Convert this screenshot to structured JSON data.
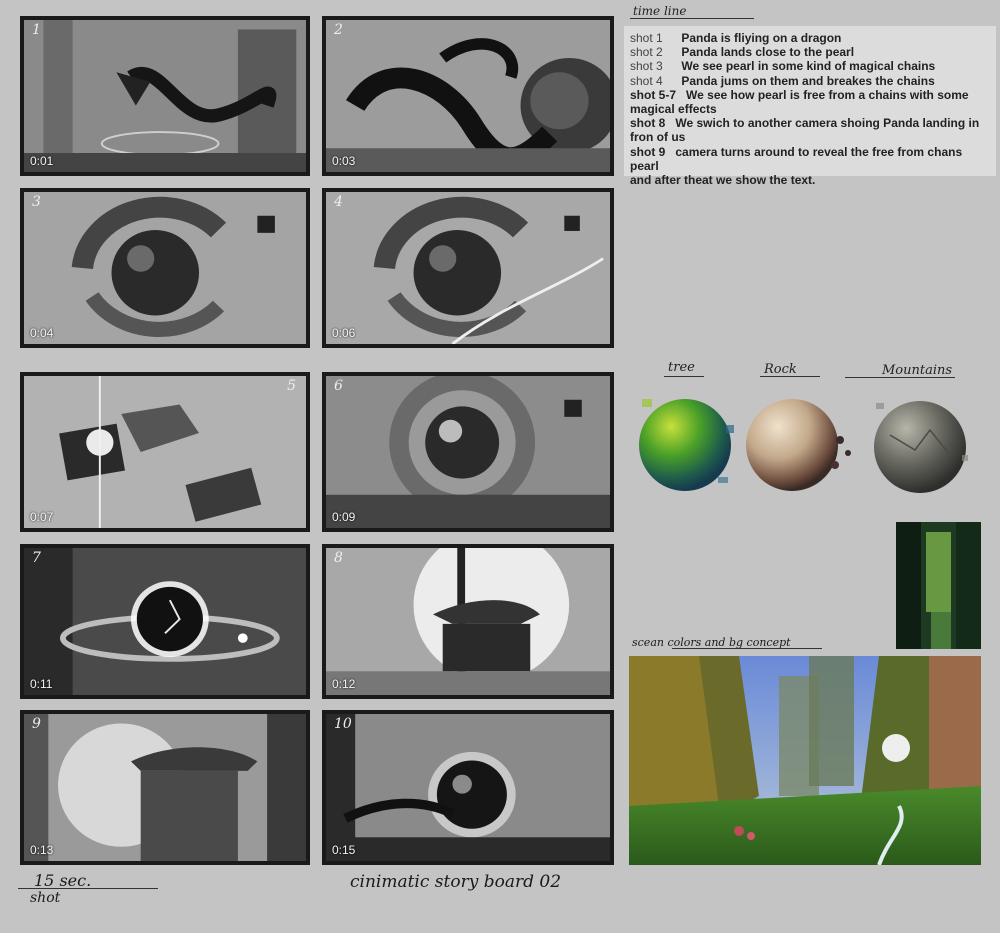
{
  "shots": [
    {
      "num": "1",
      "time": "0:01"
    },
    {
      "num": "2",
      "time": "0:03"
    },
    {
      "num": "3",
      "time": "0:04"
    },
    {
      "num": "4",
      "time": "0:06"
    },
    {
      "num": "5",
      "time": "0:07"
    },
    {
      "num": "6",
      "time": "0:09"
    },
    {
      "num": "7",
      "time": "0:11"
    },
    {
      "num": "8",
      "time": "0:12"
    },
    {
      "num": "9",
      "time": "0:13"
    },
    {
      "num": "10",
      "time": "0:15"
    }
  ],
  "timeline": {
    "title": "time line",
    "rows": [
      {
        "key": "shot 1",
        "text": "Panda is fliying on a dragon"
      },
      {
        "key": "shot 2",
        "text": "Panda lands close to the pearl"
      },
      {
        "key": "shot 3",
        "text": "We see pearl in some kind of magical chains"
      },
      {
        "key": "shot 4",
        "text": "Panda jums on them and breakes the chains"
      },
      {
        "key": "shot 5-7",
        "text": "We see how pearl is free from a chains with some"
      },
      {
        "key": "",
        "text": "magical effects"
      },
      {
        "key": "shot 8",
        "text": "We swich to another camera shoing Panda landing in"
      },
      {
        "key": "",
        "text": "fron of us"
      },
      {
        "key": "shot 9",
        "text": "camera turns around to reveal the free from chans pearl"
      },
      {
        "key": "",
        "text": "and after theat we show the text."
      }
    ]
  },
  "material_refs": {
    "tree": "tree",
    "rock": "Rock",
    "mountains": "Mountains"
  },
  "concept_label": "scean   colors and bg concept",
  "footer": {
    "duration_line1": "15 sec.",
    "duration_line2": "shot",
    "board_title": "cinimatic story board 02"
  },
  "colors": {
    "frame_border": "#1a1a1a",
    "tree_green": "#4aa028",
    "rock_tan": "#c2a88a",
    "mountain_grey": "#6e6e66"
  }
}
